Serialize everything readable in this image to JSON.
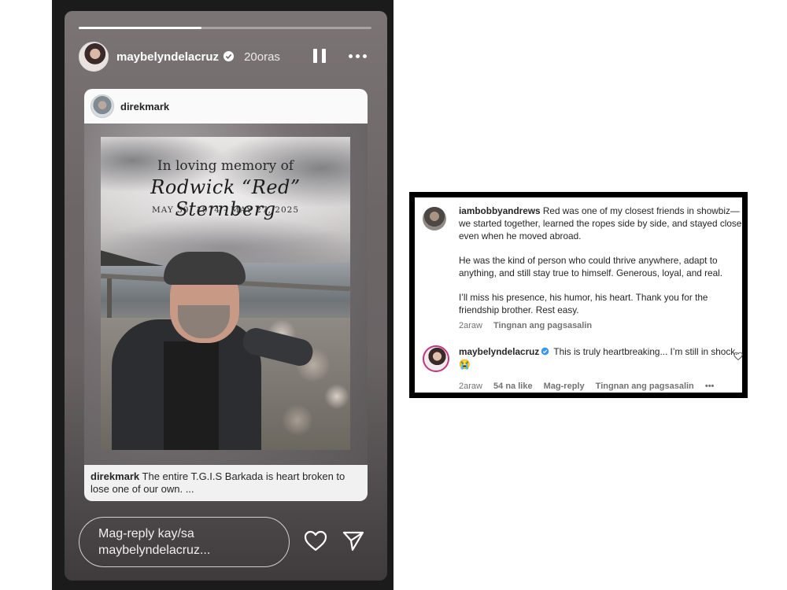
{
  "story": {
    "username": "maybelyndelacruz",
    "time": "20oras",
    "progress_fraction": 0.42,
    "shared_post": {
      "username": "direkmark",
      "image_text": {
        "line1": "In loving memory of",
        "name": "Rodwick “Red” Sternberg",
        "dates": "MAY 30, 1974 - MAY 27, 2025"
      },
      "caption_user": "direkmark",
      "caption_text": "The entire T.G.I.S Barkada is heart broken to lose one of our own. ..."
    },
    "reply_placeholder_line1": "Mag-reply kay/sa",
    "reply_placeholder_line2": "maybelyndelacruz..."
  },
  "comments": [
    {
      "username": "iambobbyandrews",
      "paragraphs": [
        "Red was one of my closest friends in showbiz—we started together, learned the ropes side by side, and stayed close even when he moved abroad.",
        "He was the kind of person who could thrive anywhere, adapt to anything, and still stay true to himself. Generous, loyal, and real.",
        "I’ll miss his presence, his humor, his heart. Thank you for the friendship brother. Rest easy."
      ],
      "time": "2araw",
      "translate": "Tingnan ang pagsasalin"
    },
    {
      "username": "maybelyndelacruz",
      "text": "This is truly heartbreaking... I’m still in shock. 😭",
      "time": "2araw",
      "likes": "54 na like",
      "reply": "Mag-reply",
      "translate": "Tingnan ang pagsasalin",
      "more": "•••"
    }
  ],
  "icons": {
    "verified": "verified-badge-icon",
    "pause": "pause-icon",
    "more": "more-options-icon",
    "heart": "heart-icon",
    "send": "send-icon"
  },
  "colors": {
    "verified_blue": "#3897f0",
    "story_ring": "#c13584"
  }
}
